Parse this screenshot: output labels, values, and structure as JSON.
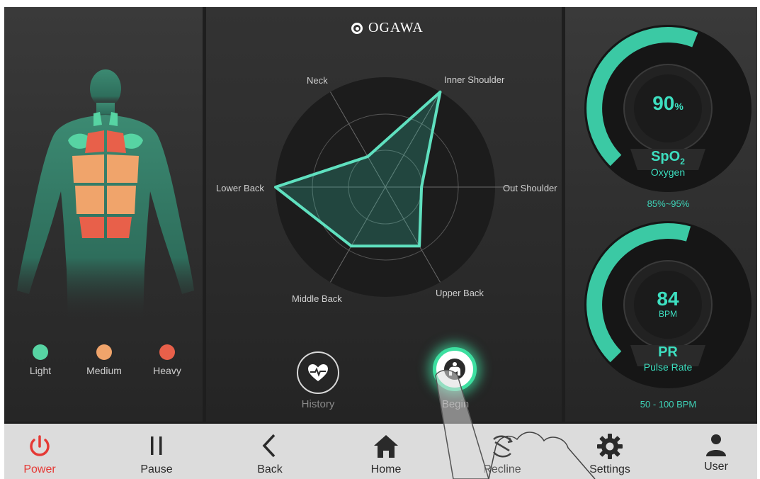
{
  "brand": {
    "name": "OGAWA"
  },
  "colors": {
    "light": "#57d4a3",
    "medium": "#f0a46b",
    "heavy": "#e8604a",
    "accent": "#3ddfc0",
    "power": "#e53935"
  },
  "intensity_legend": [
    {
      "label": "Light"
    },
    {
      "label": "Medium"
    },
    {
      "label": "Heavy"
    }
  ],
  "radar": {
    "axes": [
      "Neck",
      "Inner Shoulder",
      "Out Shoulder",
      "Upper Back",
      "Middle Back",
      "Lower Back"
    ],
    "values": [
      0.32,
      1.0,
      0.33,
      0.62,
      0.62,
      1.0
    ]
  },
  "actions": {
    "history_label": "History",
    "begin_label": "Begin"
  },
  "spo2": {
    "value": "90",
    "unit": "%",
    "title": "SpO",
    "title_sub": "2",
    "subtitle": "Oxygen",
    "range": "85%~95%",
    "level": 0.9
  },
  "pulse": {
    "value": "84",
    "unit": "BPM",
    "title": "PR",
    "subtitle": "Pulse Rate",
    "range": "50 - 100 BPM",
    "level": 0.84
  },
  "toolbar": [
    {
      "label": "Power",
      "icon": "power-icon"
    },
    {
      "label": "Pause",
      "icon": "pause-icon"
    },
    {
      "label": "Back",
      "icon": "back-chevron-icon"
    },
    {
      "label": "Home",
      "icon": "home-icon"
    },
    {
      "label": "Recline",
      "icon": "recline-icon"
    },
    {
      "label": "Settings",
      "icon": "gear-icon"
    },
    {
      "label": "User",
      "icon": "user-icon"
    }
  ]
}
